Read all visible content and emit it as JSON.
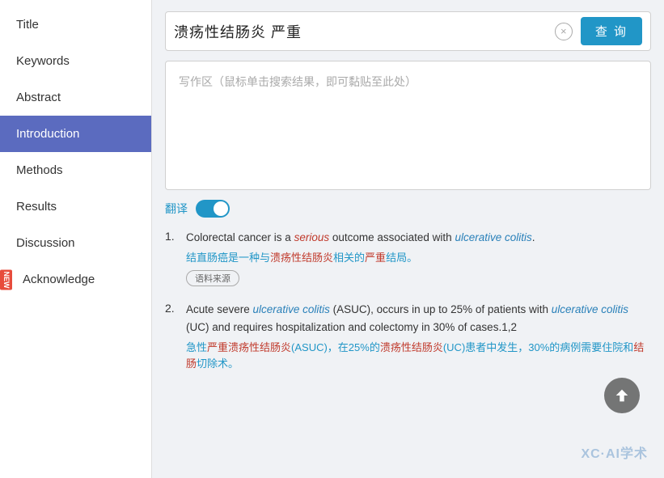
{
  "sidebar": {
    "items": [
      {
        "id": "title",
        "label": "Title",
        "active": false,
        "isNew": false
      },
      {
        "id": "keywords",
        "label": "Keywords",
        "active": false,
        "isNew": false
      },
      {
        "id": "abstract",
        "label": "Abstract",
        "active": false,
        "isNew": false
      },
      {
        "id": "introduction",
        "label": "Introduction",
        "active": true,
        "isNew": false
      },
      {
        "id": "methods",
        "label": "Methods",
        "active": false,
        "isNew": false
      },
      {
        "id": "results",
        "label": "Results",
        "active": false,
        "isNew": false
      },
      {
        "id": "discussion",
        "label": "Discussion",
        "active": false,
        "isNew": false
      },
      {
        "id": "acknowledge",
        "label": "Acknowledge",
        "active": false,
        "isNew": true
      }
    ]
  },
  "searchBar": {
    "queryText": "溃疡性结肠炎 严重",
    "clearLabel": "×",
    "queryBtnLabel": "查 询"
  },
  "writingArea": {
    "placeholder": "写作区（鼠标单击搜索结果，即可黏贴至此处）"
  },
  "translate": {
    "label": "翻译"
  },
  "results": [
    {
      "num": "1.",
      "en_parts": [
        {
          "text": "Colorectal cancer is a ",
          "style": "normal"
        },
        {
          "text": "serious",
          "style": "italic-red"
        },
        {
          "text": " outcome associated with ",
          "style": "normal"
        },
        {
          "text": "ulcerative colitis",
          "style": "italic-blue"
        },
        {
          "text": ".",
          "style": "normal"
        }
      ],
      "cn": "结直肠癌是一种与溃疡性结肠炎相关的严重结局。",
      "cn_parts": [
        {
          "text": "结直肠癌是一种与",
          "style": "normal"
        },
        {
          "text": "溃疡性结肠炎",
          "style": "red"
        },
        {
          "text": "相关的",
          "style": "normal"
        },
        {
          "text": "严重",
          "style": "red"
        },
        {
          "text": "结局。",
          "style": "normal"
        }
      ],
      "sourceTag": "语料来源"
    },
    {
      "num": "2.",
      "en_parts": [
        {
          "text": "Acute severe ",
          "style": "normal"
        },
        {
          "text": "ulcerative colitis",
          "style": "italic-blue"
        },
        {
          "text": " (ASUC), occurs in up to 25% of patients with ",
          "style": "normal"
        },
        {
          "text": "ulcerative colitis",
          "style": "italic-blue"
        },
        {
          "text": " (UC) and requires hospitalization and colectomy in 30% of cases.1,2",
          "style": "normal"
        }
      ],
      "cn_parts": [
        {
          "text": "急性",
          "style": "normal"
        },
        {
          "text": "严重溃疡性结肠炎",
          "style": "red"
        },
        {
          "text": "(ASUC)，在25%的",
          "style": "normal"
        },
        {
          "text": "溃疡性结肠炎",
          "style": "red"
        },
        {
          "text": "(UC)患者中发生，30%的病例需要住院和",
          "style": "normal"
        },
        {
          "text": "结肠",
          "style": "red"
        },
        {
          "text": "切除术。",
          "style": "normal"
        }
      ],
      "sourceTag": null
    }
  ],
  "newBadgeLabel": "NEW",
  "watermark": "XC·AI学术"
}
